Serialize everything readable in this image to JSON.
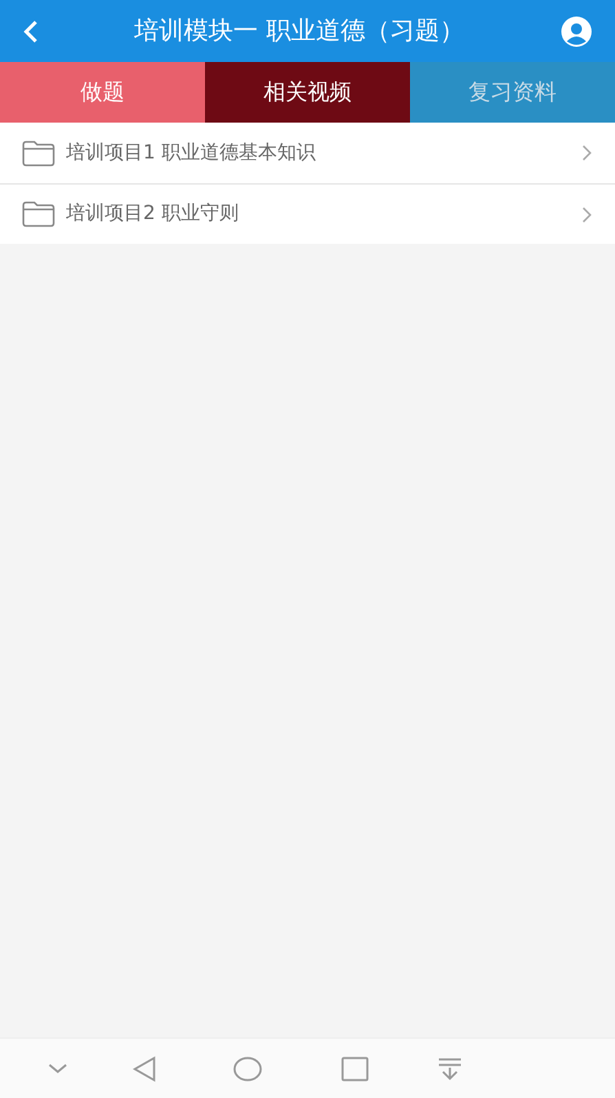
{
  "header": {
    "title": "培训模块一 职业道德（习题）"
  },
  "tabs": [
    {
      "label": "做题",
      "color": "#e8606c"
    },
    {
      "label": "相关视频",
      "color": "#6e0a14"
    },
    {
      "label": "复习资料",
      "color": "#2a8fc4"
    }
  ],
  "items": [
    {
      "label": "培训项目1 职业道德基本知识"
    },
    {
      "label": "培训项目2 职业守则"
    }
  ]
}
